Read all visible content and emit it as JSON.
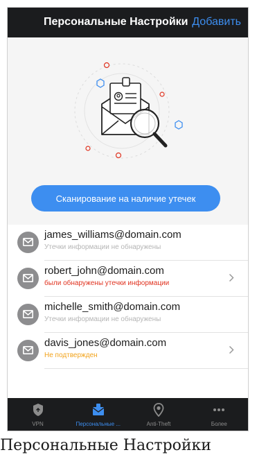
{
  "header": {
    "title": "Персональные Настройки",
    "add_label": "Добавить"
  },
  "hero": {
    "illustration_icon": "mail-search-icon",
    "scan_button_label": "Сканирование на наличие утечек"
  },
  "emails": [
    {
      "address": "james_williams@domain.com",
      "status": "Утечки информации не обнаружены",
      "status_type": "ok",
      "has_chevron": false
    },
    {
      "address": "robert_john@domain.com",
      "status": "были обнаружены утечки информации",
      "status_type": "warn",
      "has_chevron": true
    },
    {
      "address": "michelle_smith@domain.com",
      "status": "Утечки информации не обнаружены",
      "status_type": "ok",
      "has_chevron": false
    },
    {
      "address": "davis_jones@domain.com",
      "status": "Не подтвержден",
      "status_type": "pending",
      "has_chevron": true
    }
  ],
  "tabbar": {
    "tabs": [
      {
        "label": "VPN",
        "icon": "shield-icon",
        "active": false
      },
      {
        "label": "Персональные ...",
        "icon": "person-mail-icon",
        "active": true
      },
      {
        "label": "Anti-Theft",
        "icon": "location-pin-icon",
        "active": false
      },
      {
        "label": "Более",
        "icon": "more-dots-icon",
        "active": false
      }
    ]
  },
  "caption": "Персональные Настройки",
  "colors": {
    "accent": "#3d8ef0",
    "header_bg": "#1b1c1e",
    "warn": "#e0321f",
    "pending": "#f2a31c",
    "muted": "#b5b5b5"
  }
}
